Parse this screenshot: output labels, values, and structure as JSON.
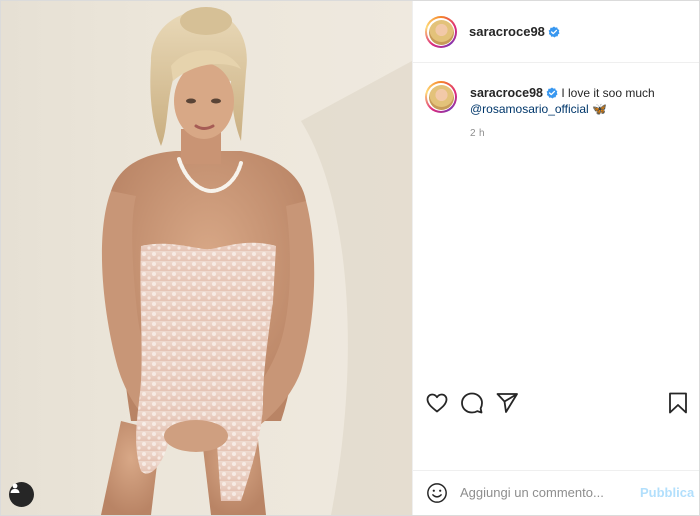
{
  "post": {
    "username": "saracroce98",
    "verified": true,
    "caption": {
      "username": "saracroce98",
      "text": "I love it soo much",
      "mention": "@rosamosario_official",
      "emoji": "🦋"
    },
    "time": "2 h"
  },
  "comment": {
    "placeholder": "Aggiungi un commento...",
    "publish_label": "Pubblica"
  },
  "icons": {
    "like": "heart-icon",
    "comment": "comment-icon",
    "share": "paper-plane-icon",
    "save": "bookmark-icon",
    "emoji": "emoji-icon",
    "tags": "user-tag-icon"
  },
  "colors": {
    "verified": "#3897f0",
    "mention": "#00376b",
    "publish": "#b2dffc"
  }
}
